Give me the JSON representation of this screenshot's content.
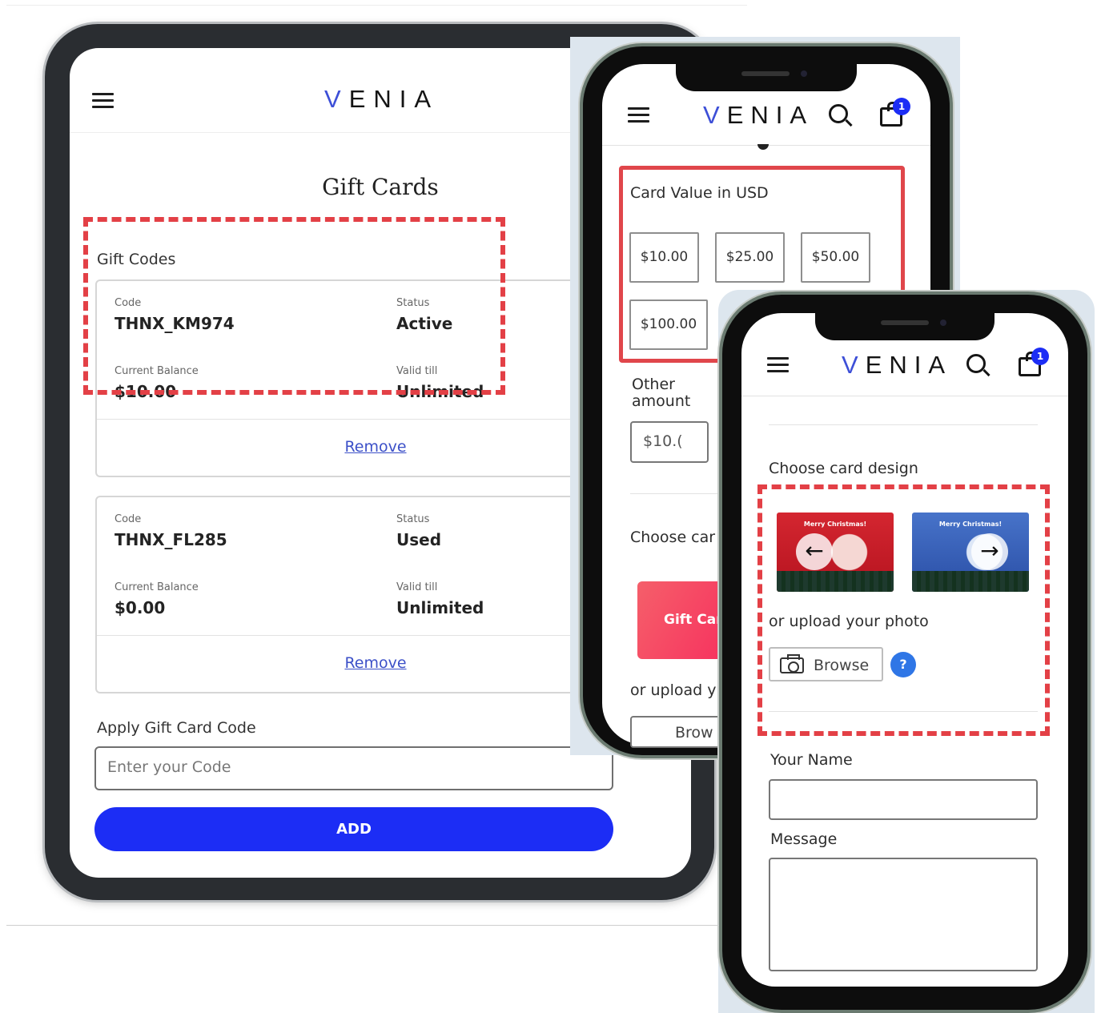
{
  "brand": {
    "logo": "VENIA",
    "logo_first": "V",
    "logo_rest": "ENIA",
    "cart_count": "1",
    "accent": "#1c2df5",
    "highlight": "#e34046"
  },
  "tablet": {
    "page_title": "Gift Cards",
    "section_label": "Gift Codes",
    "cards": [
      {
        "code_label": "Code",
        "code": "THNX_KM974",
        "status_label": "Status",
        "status": "Active",
        "balance_label": "Current Balance",
        "balance": "$10.00",
        "valid_label": "Valid till",
        "valid": "Unlimited",
        "remove": "Remove"
      },
      {
        "code_label": "Code",
        "code": "THNX_FL285",
        "status_label": "Status",
        "status": "Used",
        "balance_label": "Current Balance",
        "balance": "$0.00",
        "valid_label": "Valid till",
        "valid": "Unlimited",
        "remove": "Remove"
      }
    ],
    "apply_label": "Apply Gift Card Code",
    "code_placeholder": "Enter your Code",
    "add_button": "ADD"
  },
  "phone1": {
    "card_value_label": "Card Value in USD",
    "amounts": [
      "$10.00",
      "$25.00",
      "$50.00",
      "$100.00"
    ],
    "other_amount_label": "Other amount",
    "other_amount_value": "$10.(",
    "choose_design_label": "Choose car",
    "gift_card_text": "Gift Car",
    "upload_label": "or upload y",
    "browse_label": "Brow"
  },
  "phone2": {
    "choose_design_label": "Choose card design",
    "designs": [
      {
        "caption": "Merry Christmas!"
      },
      {
        "caption": "Merry Christmas!"
      }
    ],
    "upload_label": "or upload your photo",
    "browse_label": "Browse",
    "help_label": "?",
    "your_name_label": "Your Name",
    "message_label": "Message"
  }
}
